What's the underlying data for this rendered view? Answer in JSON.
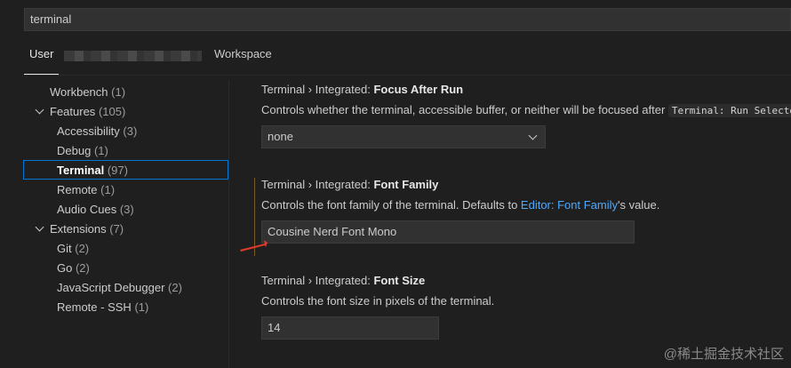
{
  "search": {
    "value": "terminal"
  },
  "tabs": {
    "user": "User",
    "workspace": "Workspace"
  },
  "toc": [
    {
      "label": "Workbench",
      "count": "(1)"
    },
    {
      "label": "Features",
      "count": "(105)"
    },
    {
      "label": "Accessibility",
      "count": "(3)"
    },
    {
      "label": "Debug",
      "count": "(1)"
    },
    {
      "label": "Terminal",
      "count": "(97)"
    },
    {
      "label": "Remote",
      "count": "(1)"
    },
    {
      "label": "Audio Cues",
      "count": "(3)"
    },
    {
      "label": "Extensions",
      "count": "(7)"
    },
    {
      "label": "Git",
      "count": "(2)"
    },
    {
      "label": "Go",
      "count": "(2)"
    },
    {
      "label": "JavaScript Debugger",
      "count": "(2)"
    },
    {
      "label": "Remote - SSH",
      "count": "(1)"
    }
  ],
  "settings": {
    "focus_after_run": {
      "prefix": "Terminal › Integrated: ",
      "name": "Focus After Run",
      "desc": "Controls whether the terminal, accessible buffer, or neither will be focused after",
      "code": "Terminal: Run Selected",
      "value": "none"
    },
    "font_family": {
      "prefix": "Terminal › Integrated: ",
      "name": "Font Family",
      "desc_before": "Controls the font family of the terminal. Defaults to ",
      "link": "Editor: Font Family",
      "desc_after": "'s value.",
      "value": "Cousine Nerd Font Mono"
    },
    "font_size": {
      "prefix": "Terminal › Integrated: ",
      "name": "Font Size",
      "desc": "Controls the font size in pixels of the terminal.",
      "value": "14"
    }
  },
  "watermark": "@稀土掘金技术社区",
  "colors": {
    "accent": "#0078d4",
    "link": "#4daafc",
    "annotation_arrow": "#e03a2a",
    "modified_bar": "#7a5b2a"
  }
}
